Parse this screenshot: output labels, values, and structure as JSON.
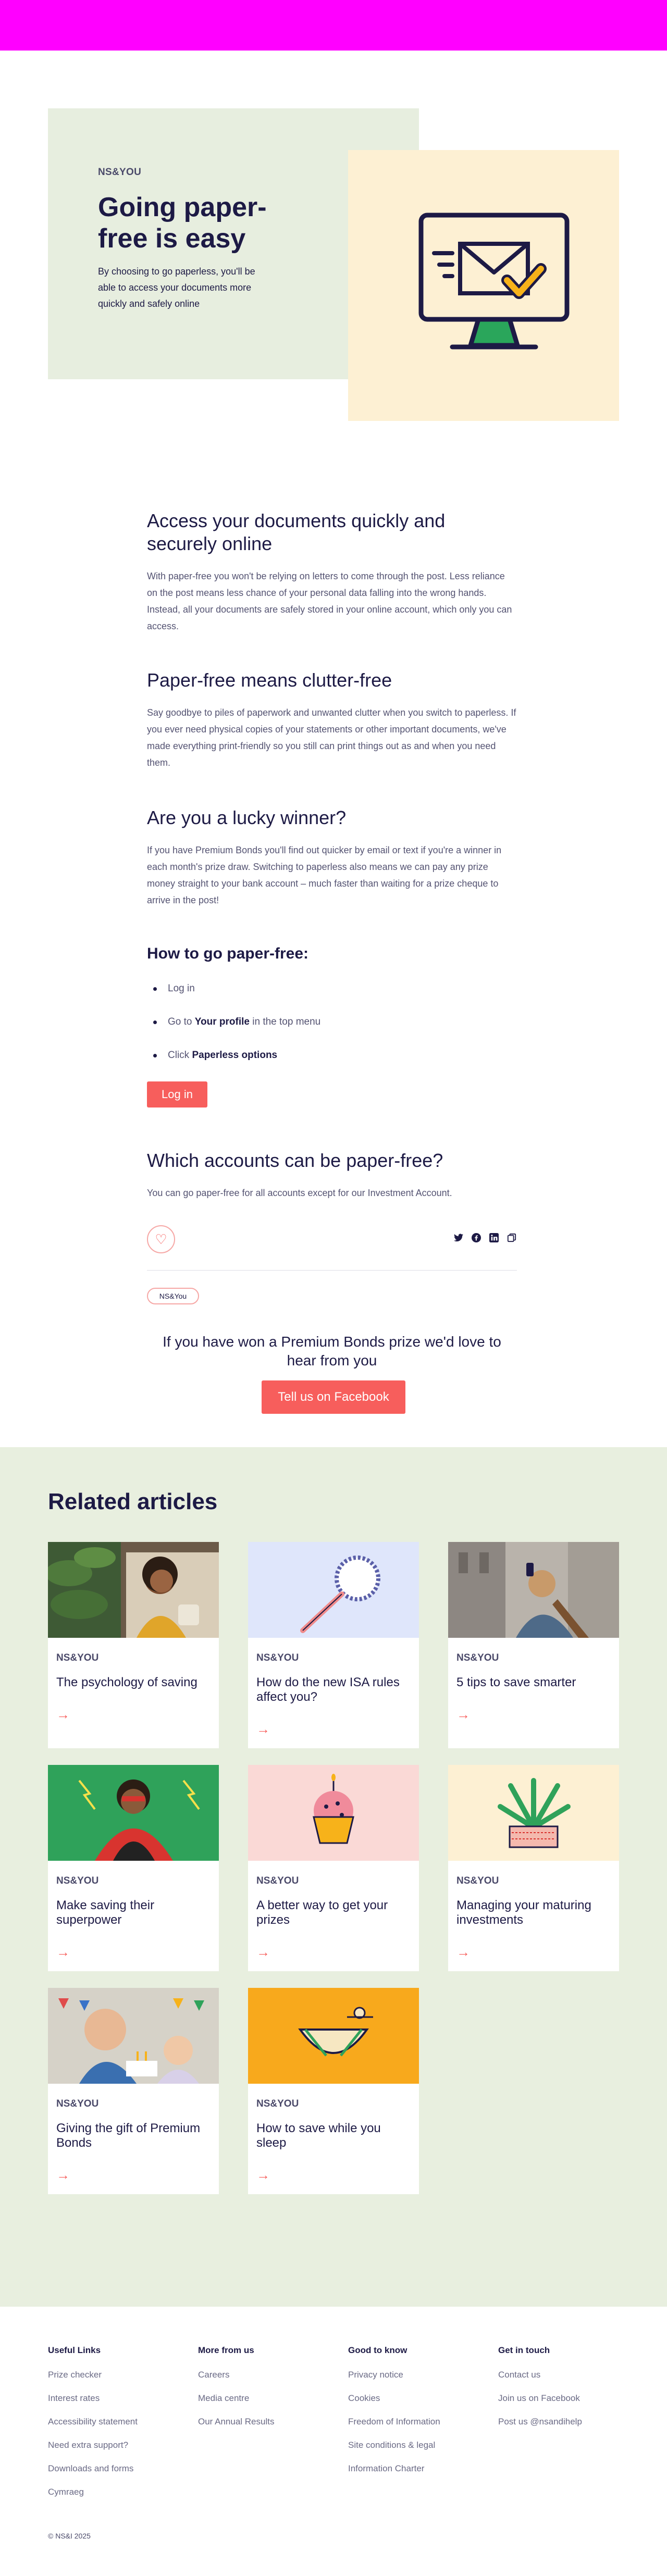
{
  "hero": {
    "eyebrow": "NS&YOU",
    "title": "Going paper-free is easy",
    "description": "By choosing to go paperless, you'll be able to access your documents more quickly and safely online"
  },
  "sections": {
    "access_title": "Access your documents quickly and securely online",
    "access_body": "With paper-free you won't be relying on letters to come through the post. Less reliance on the post means less chance of your personal data falling into the wrong hands. Instead, all your documents are safely stored in your online account, which only you can access.",
    "clutter_title": "Paper-free means clutter-free",
    "clutter_body": "Say goodbye to piles of paperwork and unwanted clutter when you switch to paperless. If you ever need physical copies of your statements or other important documents, we've made everything print-friendly so you still can print things out as and when you need them.",
    "winner_title": "Are you a lucky winner?",
    "winner_body": "If you have Premium Bonds you'll find out quicker by email or text if you're a winner in each month's prize draw. Switching to paperless also means we can pay any prize money straight to your bank account – much faster than waiting for a prize cheque to arrive in the post!",
    "howto_title": "How to go paper-free:",
    "steps": [
      {
        "pre": "Log in",
        "bold": "",
        "post": ""
      },
      {
        "pre": "Go to ",
        "bold": "Your profile",
        "post": " in the top menu"
      },
      {
        "pre": "Click ",
        "bold": "Paperless options",
        "post": ""
      }
    ],
    "login_button": "Log in",
    "accounts_title": "Which accounts can be paper-free?",
    "accounts_body": "You can go paper-free for all accounts except for our Investment Account."
  },
  "tag": "NS&You",
  "facebook": {
    "text": "If you have won a Premium Bonds prize we'd love to hear from you",
    "button": "Tell us on Facebook"
  },
  "icons": {
    "heart": "heart-icon",
    "share": [
      "twitter-icon",
      "facebook-icon",
      "linkedin-icon",
      "copy-link-icon"
    ],
    "arrow": "arrow-right-icon"
  },
  "related": {
    "title": "Related articles",
    "cards": [
      {
        "eyebrow": "NS&YOU",
        "title": "The psychology of saving",
        "image": "woman-with-plants"
      },
      {
        "eyebrow": "NS&YOU",
        "title": "How do the new ISA rules affect you?",
        "image": "magnifying-glass-pencil"
      },
      {
        "eyebrow": "NS&YOU",
        "title": "5 tips to save smarter",
        "image": "woman-phone-city"
      },
      {
        "eyebrow": "NS&YOU",
        "title": "Make saving their superpower",
        "image": "superhero-girl"
      },
      {
        "eyebrow": "NS&YOU",
        "title": "A better way to get your prizes",
        "image": "cupcake"
      },
      {
        "eyebrow": "NS&YOU",
        "title": "Managing your maturing investments",
        "image": "plant-pot"
      },
      {
        "eyebrow": "NS&YOU",
        "title": "Giving the gift of Premium Bonds",
        "image": "birthday-children"
      },
      {
        "eyebrow": "NS&YOU",
        "title": "How to save while you sleep",
        "image": "sleeping-bowl"
      }
    ]
  },
  "footer": {
    "columns": [
      {
        "title": "Useful Links",
        "links": [
          "Prize checker",
          "Interest rates",
          "Accessibility statement",
          "Need extra support?",
          "Downloads and forms",
          "Cymraeg"
        ]
      },
      {
        "title": "More from us",
        "links": [
          "Careers",
          "Media centre",
          "Our Annual Results"
        ]
      },
      {
        "title": "Good to know",
        "links": [
          "Privacy notice",
          "Cookies",
          "Freedom of Information",
          "Site conditions & legal",
          "Information Charter"
        ]
      },
      {
        "title": "Get in touch",
        "links": [
          "Contact us",
          "Join us on Facebook",
          "Post us @nsandihelp"
        ]
      }
    ],
    "copyright": "© NS&I 2025"
  },
  "colors": {
    "accent": "#f75e5c",
    "navy": "#1d1a45",
    "hero_green": "#e7eedf",
    "hero_cream": "#fdf0d3",
    "top_bar": "#ff00ff"
  }
}
